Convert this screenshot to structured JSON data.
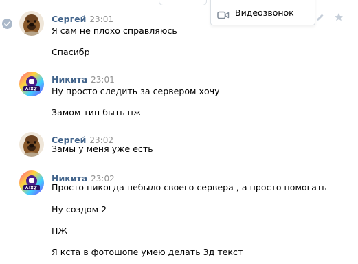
{
  "menu": {
    "video_call_label": "Видеозвонок",
    "icons": [
      "video-camera-icon",
      "pencil-icon",
      "star-icon"
    ]
  },
  "messages": [
    {
      "sender": "Сергей",
      "time": "23:01",
      "avatar": "alf-avatar",
      "lines": [
        "Я сам не плохо справляюсь",
        "Спасибр"
      ]
    },
    {
      "sender": "Никита",
      "time": "23:01",
      "avatar": "hazzy-logo-avatar",
      "lines": [
        "Ну просто следить за сервером хочу",
        "Замом тип быть пж"
      ]
    },
    {
      "sender": "Сергей",
      "time": "23:02",
      "avatar": "alf-avatar",
      "lines": [
        "Замы у меня уже есть"
      ]
    },
    {
      "sender": "Никита",
      "time": "23:02",
      "avatar": "hazzy-logo-avatar",
      "lines": [
        "Просто никогда небыло своего сервера , а просто помогать",
        "Ну создом 2",
        "ПЖ",
        "Я кста в фотошопе умею делать 3д текст"
      ]
    }
  ],
  "colors": {
    "sender_name": "#42648b",
    "timestamp": "#939393",
    "icon_gray": "#aab8c9"
  }
}
